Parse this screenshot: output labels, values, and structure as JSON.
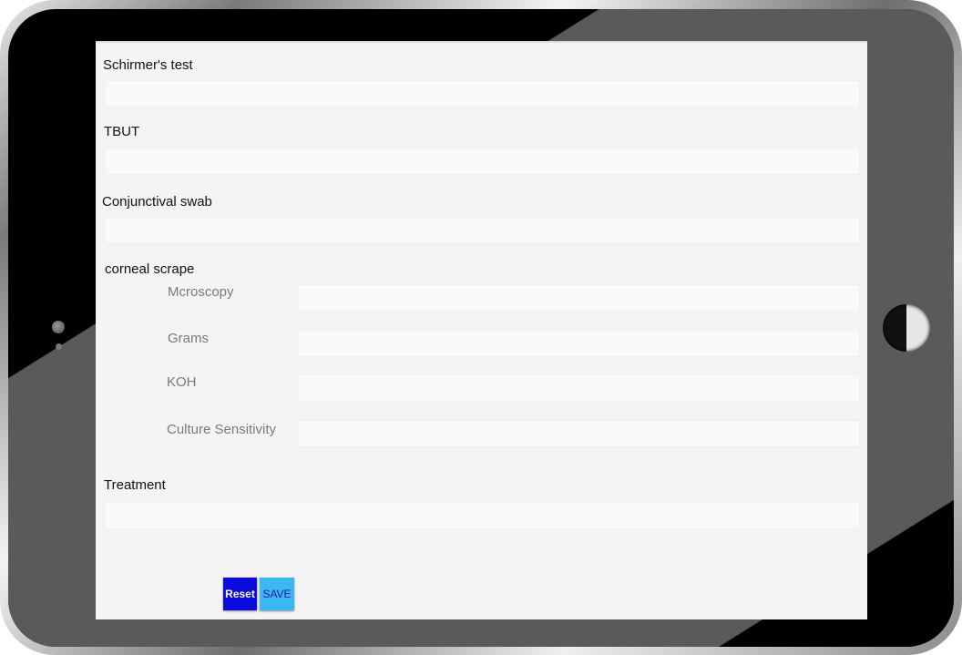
{
  "form": {
    "schirmers_label": "Schirmer's test",
    "schirmers_value": "",
    "tbut_label": "TBUT",
    "tbut_value": "",
    "conjunctival_label": "Conjunctival swab",
    "conjunctival_value": "",
    "corneal_label": "corneal scrape",
    "corneal": {
      "microscopy_label": "Mcroscopy",
      "microscopy_value": "",
      "grams_label": "Grams",
      "grams_value": "",
      "koh_label": "KOH",
      "koh_value": "",
      "culture_label": "Culture Sensitivity",
      "culture_value": ""
    },
    "treatment_label": "Treatment",
    "treatment_value": ""
  },
  "buttons": {
    "reset_label": "Reset",
    "save_label": "SAVE"
  },
  "colors": {
    "reset_bg": "#0b0bde",
    "save_bg": "#3ab8f2",
    "screen_bg": "#f4f4f4"
  }
}
